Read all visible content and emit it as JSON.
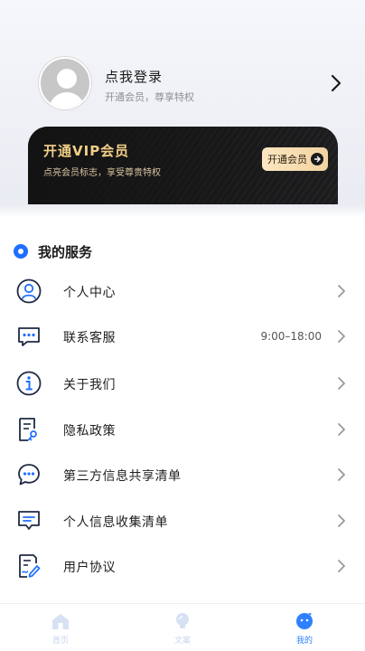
{
  "profile": {
    "login_title": "点我登录",
    "login_subtitle": "开通会员，尊享特权"
  },
  "vip": {
    "title": "开通VIP会员",
    "subtitle": "点亮会员标志，享受尊贵特权",
    "button_label": "开通会员"
  },
  "services": {
    "title": "我的服务",
    "items": [
      {
        "label": "个人中心",
        "icon": "user-circle-icon",
        "value": ""
      },
      {
        "label": "联系客服",
        "icon": "chat-bubble-icon",
        "value": "9:00–18:00"
      },
      {
        "label": "关于我们",
        "icon": "info-icon",
        "value": ""
      },
      {
        "label": "隐私政策",
        "icon": "privacy-doc-icon",
        "value": ""
      },
      {
        "label": "第三方信息共享清单",
        "icon": "share-chat-icon",
        "value": ""
      },
      {
        "label": "个人信息收集清单",
        "icon": "message-list-icon",
        "value": ""
      },
      {
        "label": "用户协议",
        "icon": "agreement-doc-icon",
        "value": ""
      }
    ]
  },
  "tabbar": {
    "tabs": [
      {
        "label": "首页",
        "icon": "home-icon",
        "active": false
      },
      {
        "label": "文案",
        "icon": "lightbulb-icon",
        "active": false
      },
      {
        "label": "我的",
        "icon": "profile-face-icon",
        "active": true
      }
    ]
  },
  "colors": {
    "accent": "#1e6fff",
    "vip_gold": "#f2cf86",
    "tab_active": "#2f80ff",
    "tab_inactive": "#c9d5ee"
  }
}
